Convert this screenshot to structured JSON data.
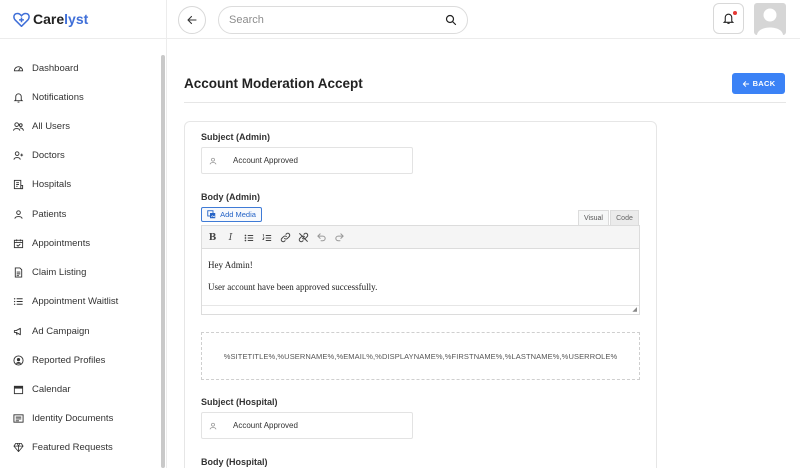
{
  "app": {
    "brand_prefix": "Care",
    "brand_suffix": "lyst"
  },
  "search": {
    "placeholder": "Search"
  },
  "sidebar": {
    "items": [
      {
        "label": "Dashboard",
        "icon": "gauge-icon"
      },
      {
        "label": "Notifications",
        "icon": "bell-icon"
      },
      {
        "label": "All Users",
        "icon": "users-icon"
      },
      {
        "label": "Doctors",
        "icon": "user-plus-icon"
      },
      {
        "label": "Hospitals",
        "icon": "hospital-icon"
      },
      {
        "label": "Patients",
        "icon": "user-icon"
      },
      {
        "label": "Appointments",
        "icon": "calendar-check-icon"
      },
      {
        "label": "Claim Listing",
        "icon": "document-icon"
      },
      {
        "label": "Appointment Waitlist",
        "icon": "list-icon"
      },
      {
        "label": "Ad Campaign",
        "icon": "megaphone-icon"
      },
      {
        "label": "Reported Profiles",
        "icon": "user-circle-icon"
      },
      {
        "label": "Calendar",
        "icon": "calendar-icon"
      },
      {
        "label": "Identity Documents",
        "icon": "id-card-icon"
      },
      {
        "label": "Featured Requests",
        "icon": "diamond-icon"
      }
    ]
  },
  "page": {
    "title": "Account Moderation Accept",
    "back_label": "BACK"
  },
  "form": {
    "subject_admin_label": "Subject (Admin)",
    "subject_admin_value": "Account Approved",
    "body_admin_label": "Body (Admin)",
    "add_media_label": "Add Media",
    "tab_visual": "Visual",
    "tab_code": "Code",
    "body_line1": "Hey Admin!",
    "body_line2": "User account have been approved successfully.",
    "placeholders": "%SITETITLE%,%USERNAME%,%EMAIL%,%DISPLAYNAME%,%FIRSTNAME%,%LASTNAME%,%USERROLE%",
    "subject_hospital_label": "Subject (Hospital)",
    "subject_hospital_value": "Account Approved",
    "body_hospital_label": "Body (Hospital)"
  },
  "colors": {
    "accent": "#3b82f6",
    "brand": "#3f6fd8",
    "notification_dot": "#e53935"
  }
}
